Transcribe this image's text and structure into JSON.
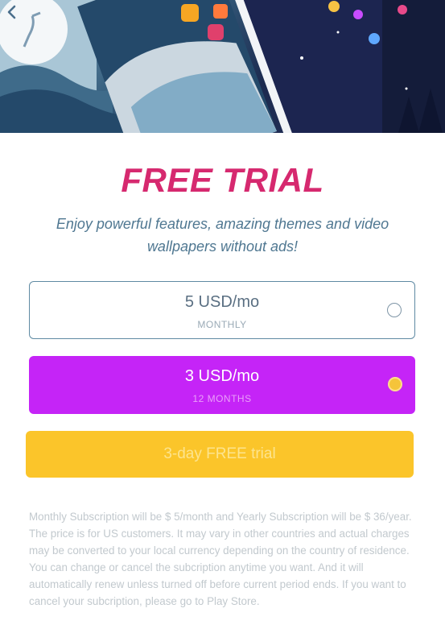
{
  "header": {
    "back_icon": "back-arrow-icon"
  },
  "promo": {
    "title": "FREE TRIAL",
    "subtitle": "Enjoy powerful features, amazing themes and video wallpapers without ads!"
  },
  "plans": [
    {
      "price": "5 USD/mo",
      "period": "MONTHLY",
      "selected": false
    },
    {
      "price": "3 USD/mo",
      "period": "12 MONTHS",
      "selected": true
    }
  ],
  "cta": {
    "label": "3-day FREE trial"
  },
  "disclaimer": "Monthly Subscription will be $ 5/month and Yearly Subscription will be $ 36/year. The price is for US customers. It may vary in other countries and actual charges may be converted to your local currency depending on the country of residence. You can change or cancel the subcription anytime you want. And it will automatically renew unless turned off before current period ends. If you want to cancel your subcription, please go to Play Store.",
  "colors": {
    "title": "#d6296f",
    "selected_plan": "#c524f7",
    "cta": "#fbc52a"
  }
}
